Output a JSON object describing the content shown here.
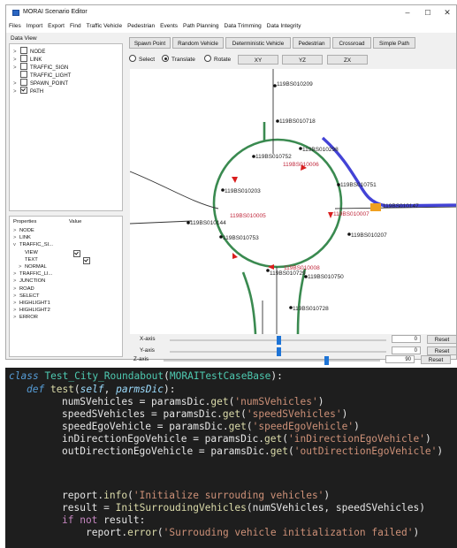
{
  "window": {
    "title": "MORAI Scenario Editor",
    "controls": [
      "–",
      "☐",
      "✕"
    ]
  },
  "menu": [
    "Files",
    "Import",
    "Export",
    "Find",
    "Traffic Vehicle",
    "Pedestrian",
    "Events",
    "Path Planning",
    "Data Trimming",
    "Data Integrity"
  ],
  "data_view": {
    "title": "Data View",
    "items": [
      {
        "label": "NODE",
        "checked": false
      },
      {
        "label": "LINK",
        "checked": false
      },
      {
        "label": "TRAFFIC_SIGN",
        "checked": false
      },
      {
        "label": "TRAFFIC_LIGHT",
        "checked": false
      },
      {
        "label": "SPAWN_POINT",
        "checked": false
      },
      {
        "label": "PATH",
        "checked": true
      }
    ]
  },
  "properties": {
    "col_name": "Properties",
    "col_value": "Value",
    "rows": [
      {
        "chev": ">",
        "label": "NODE"
      },
      {
        "chev": ">",
        "label": "LINK"
      },
      {
        "chev": "v",
        "label": "TRAFFIC_SI..."
      },
      {
        "chev": "",
        "label": "VIEW",
        "indent": true,
        "check": true
      },
      {
        "chev": "",
        "label": "TEXT",
        "indent": true,
        "check": true
      },
      {
        "chev": ">",
        "label": "NORMAL",
        "indent": true
      },
      {
        "chev": ">",
        "label": "TRAFFIC_LI..."
      },
      {
        "chev": ">",
        "label": "JUNCTION"
      },
      {
        "chev": ">",
        "label": "ROAD"
      },
      {
        "chev": ">",
        "label": "SELECT"
      },
      {
        "chev": ">",
        "label": "HIGHLIGHT1"
      },
      {
        "chev": ">",
        "label": "HIGHLIGHT2"
      },
      {
        "chev": ">",
        "label": "ERROR"
      }
    ]
  },
  "toolbar": {
    "spawn_point": "Spawn Point",
    "random_vehicle": "Random Vehicle",
    "deterministic_vehicle": "Deterministic Vehicle",
    "pedestrian": "Pedestrian",
    "crossroad": "Crossroad",
    "simple_path": "Simple Path"
  },
  "modes": {
    "select": "Select",
    "translate": "Translate",
    "rotate": "Rotate",
    "active": "Translate",
    "planes": [
      "XY",
      "YZ",
      "ZX"
    ]
  },
  "map_labels": [
    "119BS010209",
    "119BS010718",
    "119BS010752",
    "119BS010298",
    "119BS010006",
    "119BS010751",
    "119BS010203",
    "119BS010147",
    "119BS010005",
    "119BS010007",
    "119BS010144",
    "119BS010753",
    "119BS010207",
    "119BS010008",
    "119BS010729",
    "119BS010750",
    "119BS010728"
  ],
  "colors": {
    "road_edge": "#3a8a50",
    "lane": "#333333",
    "selected_path": "#4343d6",
    "arrow": "#d91e1e",
    "red_label": "#c0283c",
    "vehicle": "#f0a020",
    "slider": "#1e74d6"
  },
  "sliders": [
    {
      "label": "X-axis",
      "value": "0",
      "reset": "Reset",
      "position": 0.5
    },
    {
      "label": "Y-axis",
      "value": "0",
      "reset": "Reset",
      "position": 0.5
    },
    {
      "label": "Z-axis",
      "value": "90",
      "reset": "Reset",
      "position": 0.75
    }
  ],
  "code": {
    "l1_kw": "class",
    "l1_name": "Test_City_Roundabout",
    "l1_base": "MORAITestCaseBase",
    "l2_kw": "def",
    "l2_name": "test",
    "l2_self": "self",
    "l2_param": "parmsDic",
    "assigns": [
      {
        "var": "numSVehicles",
        "key": "'numSVehicles'"
      },
      {
        "var": "speedSVehicles",
        "key": "'speedSVehicles'"
      },
      {
        "var": "speedEgoVehicle",
        "key": "'speedEgoVehicle'"
      },
      {
        "var": "inDirectionEgoVehicle",
        "key": "'inDirectionEgoVehicle'"
      },
      {
        "var": "outDirectionEgoVehicle",
        "key": "'outDirectionEgoVehicle'"
      }
    ],
    "params_obj": "paramsDic",
    "get_fn": "get",
    "report_obj": "report",
    "info_fn": "info",
    "info_msg": "'Initialize surrouding vehicles'",
    "result_var": "result",
    "init_fn": "InitSurroudingVehicles",
    "init_args": "numSVehicles, speedSVehicles",
    "if_kw": "if not",
    "if_var": "result",
    "error_fn": "error",
    "error_msg": "'Surrouding vehicle initialization failed'"
  }
}
